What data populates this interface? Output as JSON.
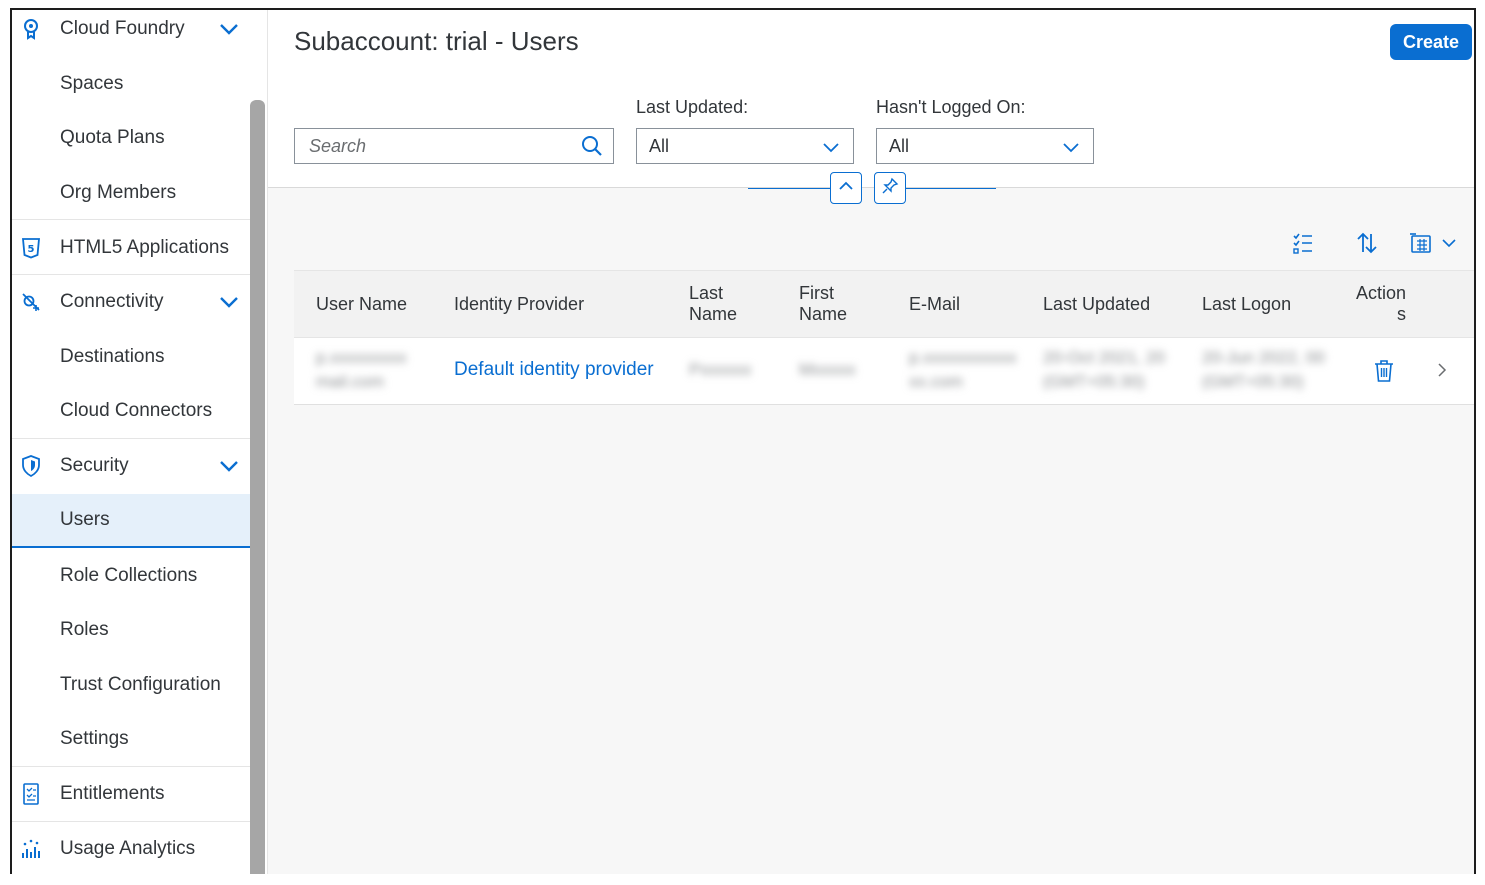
{
  "sidebar": {
    "items": [
      {
        "label": "Cloud Foundry",
        "icon": "cloud-foundry-icon",
        "expandable": true
      },
      {
        "label": "Spaces"
      },
      {
        "label": "Quota Plans"
      },
      {
        "label": "Org Members"
      },
      {
        "label": "HTML5 Applications",
        "icon": "html5-icon"
      },
      {
        "label": "Connectivity",
        "icon": "connectivity-icon",
        "expandable": true
      },
      {
        "label": "Destinations"
      },
      {
        "label": "Cloud Connectors"
      },
      {
        "label": "Security",
        "icon": "shield-icon",
        "expandable": true
      },
      {
        "label": "Users",
        "selected": true
      },
      {
        "label": "Role Collections"
      },
      {
        "label": "Roles"
      },
      {
        "label": "Trust Configuration"
      },
      {
        "label": "Settings"
      },
      {
        "label": "Entitlements",
        "icon": "entitlements-icon"
      },
      {
        "label": "Usage Analytics",
        "icon": "usage-analytics-icon"
      }
    ]
  },
  "header": {
    "title": "Subaccount: trial - Users",
    "create_label": "Create"
  },
  "filters": {
    "search_placeholder": "Search",
    "last_updated_label": "Last Updated:",
    "last_updated_value": "All",
    "hasnt_logged_on_label": "Hasn't Logged On:",
    "hasnt_logged_on_value": "All"
  },
  "table": {
    "columns": {
      "user_name": "User Name",
      "identity_provider": "Identity Provider",
      "last_name_1": "Last",
      "last_name_2": "Name",
      "first_name_1": "First",
      "first_name_2": "Name",
      "email": "E-Mail",
      "last_updated": "Last Updated",
      "last_logon": "Last Logon",
      "actions_1": "Action",
      "actions_2": "s"
    },
    "rows": [
      {
        "user_name_1": "p.xxxxxxxxx",
        "user_name_2": "mail.com",
        "identity_provider": "Default identity provider",
        "last_name": "Pxxxxxx",
        "first_name": "Mxxxxx",
        "email_1": "p.xxxxxxxxxxx",
        "email_2": "xx.com",
        "last_updated_1": "20-Oct 2021, 20",
        "last_updated_2": "(GMT+05:30)",
        "last_logon_1": "20-Jun 2022, 00",
        "last_logon_2": "(GMT+05:30)"
      }
    ]
  },
  "colors": {
    "accent": "#0a6ed1",
    "selected_bg": "#e5f0fa",
    "content_bg": "#f7f7f7"
  }
}
